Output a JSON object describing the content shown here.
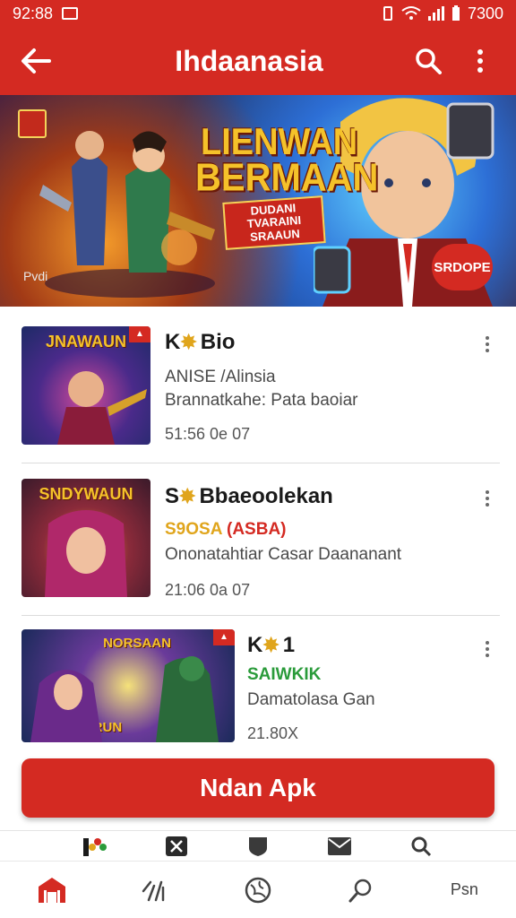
{
  "status_bar": {
    "time_left": "92:88",
    "time_right": "7300"
  },
  "app_bar": {
    "title": "Ihdaanasia"
  },
  "banner": {
    "headline_line1": "LIENWAN",
    "headline_line2": "BERMAAN",
    "sublabel": "DUDANI TVARAINI SRAAUN",
    "corner_text": "Pvdi",
    "promo_button": "SRDOPE"
  },
  "items": [
    {
      "thumb_title": "JNAWAUN",
      "name": "Bio",
      "name_prefix": "K",
      "line1": "ANISE /Alinsia",
      "line2": "Brannatkahe: Pata baoiar",
      "meta": "51:56 0e 07"
    },
    {
      "thumb_title": "SNDYWAUN",
      "name": "Bbaeoolekan",
      "name_prefix": "S",
      "tag_main": "S9OSA",
      "tag_red": "(ASBA)",
      "line2": "Ononatahtiar Casar Daananant",
      "meta": "21:06 0a 07"
    },
    {
      "thumb_title": "NORSAAN",
      "thumb_caption": "RICSERUN",
      "name": "1",
      "name_prefix": "K",
      "tag_green": "SAIWKIK",
      "line2": "Damatolasa Gan",
      "meta": "21.80X"
    }
  ],
  "download_button": {
    "label": "Ndan Apk"
  },
  "bottom_nav": {
    "last_label": "Psn"
  },
  "colors": {
    "brand_red": "#d42a22",
    "accent_yellow": "#e0a51c",
    "accent_green": "#2a9b3a"
  }
}
